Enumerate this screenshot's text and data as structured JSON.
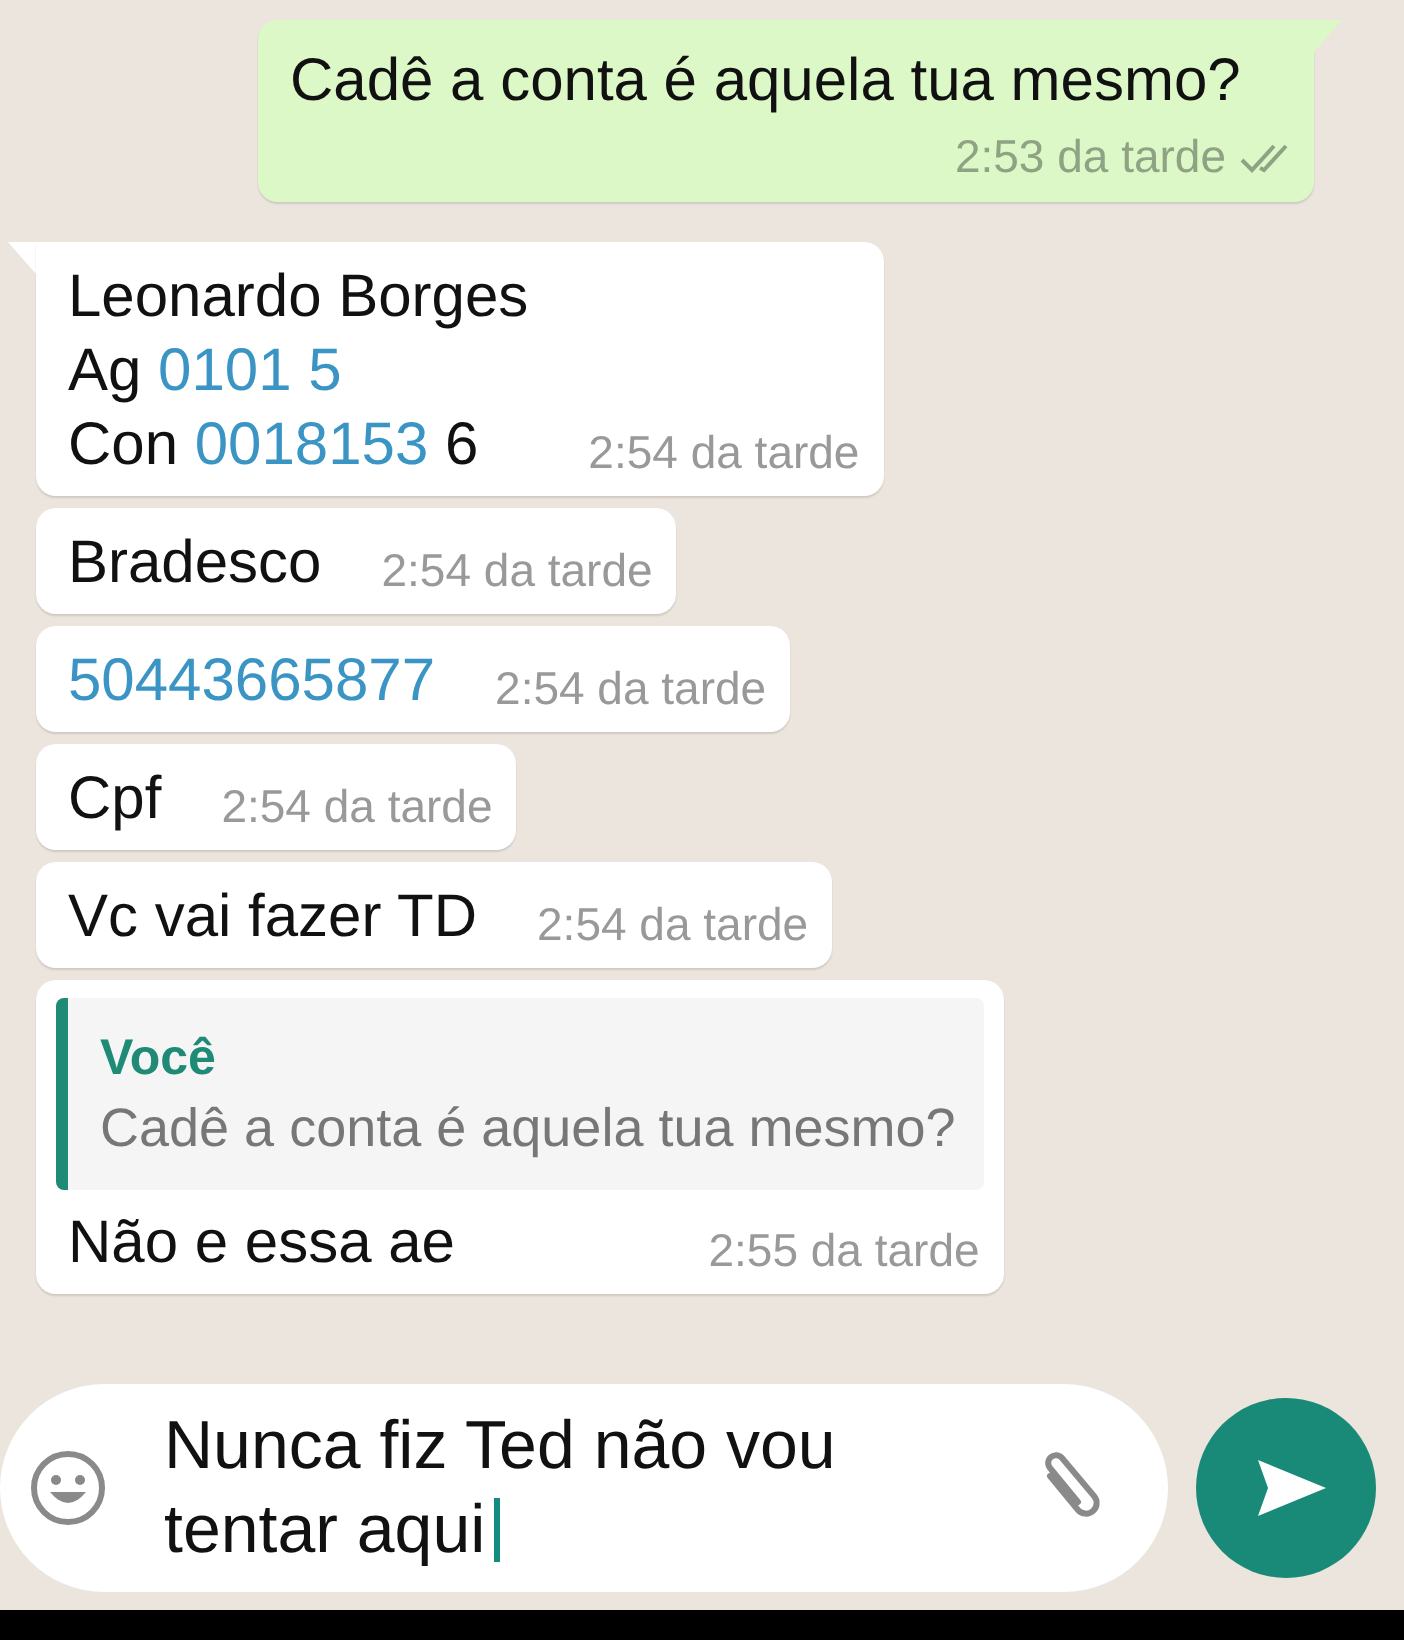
{
  "messages": [
    {
      "kind": "outgoing",
      "tail": true,
      "delivered": true,
      "lines": [
        [
          {
            "kind": "text",
            "text": "Cadê a conta é aquela tua mesmo?"
          }
        ]
      ],
      "time": "2:53 da tarde"
    },
    {
      "kind": "incoming",
      "tail": true,
      "lines": [
        [
          {
            "kind": "text",
            "text": "Leonardo Borges"
          }
        ],
        [
          {
            "kind": "text",
            "text": "Ag "
          },
          {
            "kind": "link",
            "text": "0101 5"
          }
        ],
        [
          {
            "kind": "text",
            "text": "Con "
          },
          {
            "kind": "link",
            "text": "0018153"
          },
          {
            "kind": "text",
            "text": " 6"
          }
        ]
      ],
      "time": "2:54 da tarde"
    },
    {
      "kind": "incoming",
      "tail": false,
      "lines": [
        [
          {
            "kind": "text",
            "text": "Bradesco"
          }
        ]
      ],
      "time": "2:54 da tarde"
    },
    {
      "kind": "incoming",
      "tail": false,
      "lines": [
        [
          {
            "kind": "link",
            "text": "50443665877"
          }
        ]
      ],
      "time": "2:54 da tarde"
    },
    {
      "kind": "incoming",
      "tail": false,
      "lines": [
        [
          {
            "kind": "text",
            "text": "Cpf"
          }
        ]
      ],
      "time": "2:54 da tarde"
    },
    {
      "kind": "incoming",
      "tail": false,
      "lines": [
        [
          {
            "kind": "text",
            "text": "Vc vai fazer TD"
          }
        ]
      ],
      "time": "2:54 da tarde"
    },
    {
      "kind": "incoming",
      "tail": false,
      "quote": {
        "author": "Você",
        "text": "Cadê a conta é aquela tua mesmo?"
      },
      "lines": [
        [
          {
            "kind": "text",
            "text": "Não e essa ae"
          }
        ]
      ],
      "time": "2:55 da tarde"
    }
  ],
  "composer": {
    "value": "Nunca fiz Ted não vou tentar aqui"
  }
}
